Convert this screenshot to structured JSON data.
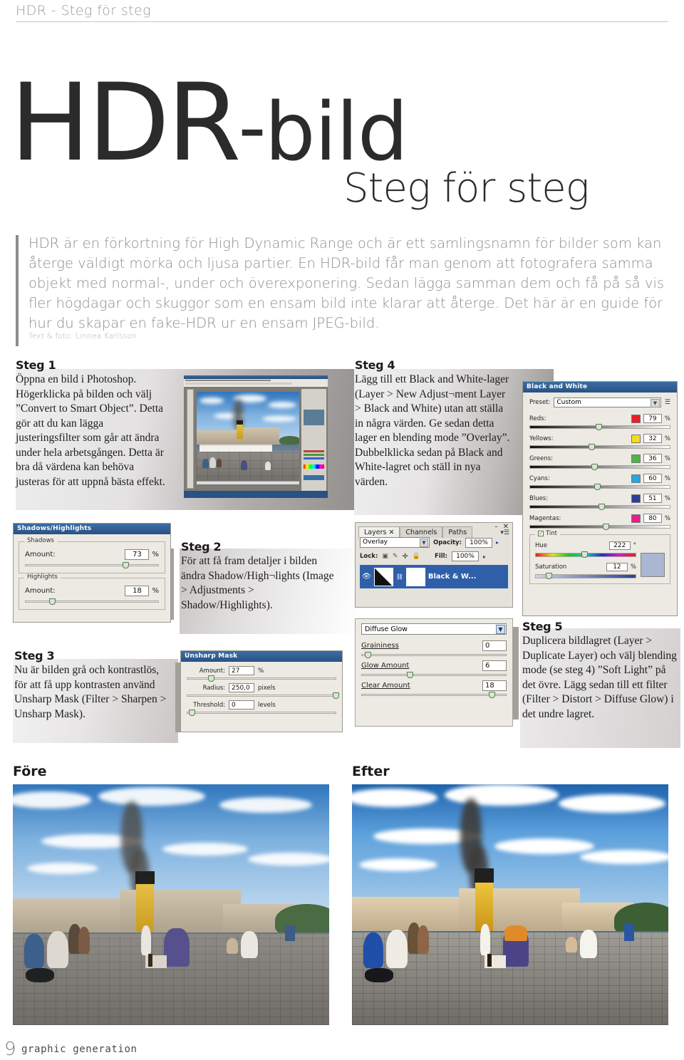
{
  "header": {
    "runhead": "HDR - Steg för steg"
  },
  "title": {
    "main_prefix": "HDR",
    "main_dash": "-",
    "main_suffix": "bild",
    "subtitle": "Steg för steg"
  },
  "intro": {
    "body": "HDR är en förkortning för High Dynamic Range och är ett samlingsnamn för bilder som kan återge väldigt mörka och ljusa partier. En HDR-bild får man genom att fotografera samma objekt med normal-, under och överexponering. Sedan lägga samman dem och få på så vis fler högdagar och skuggor som en ensam bild inte klarar att återge. Det här är en guide för hur du skapar en fake-HDR ur en ensam JPEG-bild.",
    "byline": "Text & foto: Linnea Karlsson"
  },
  "steps": [
    {
      "heading": "Steg 1",
      "body": "Öppna en bild i Photoshop. Högerklicka på bilden och välj ”Convert to Smart Object”. Detta gör att du kan lägga justeringsfilter som går att ändra under hela arbetsgången. Detta är bra då värdena kan behöva justeras för att uppnå bästa effekt."
    },
    {
      "heading": "Steg 2",
      "body": "För att få fram detaljer i bilden ändra Shadow/High¬lights (Image > Adjustments > Shadow/Highlights)."
    },
    {
      "heading": "Steg 3",
      "body": "Nu är bilden grå och kontrastlös, för att få upp kontrasten använd Unsharp Mask (Filter > Sharpen > Unsharp Mask)."
    },
    {
      "heading": "Steg 4",
      "body": "Lägg till ett Black and White-lager (Layer > New Adjust¬ment Layer > Black and White) utan att ställa in några värden. Ge sedan detta lager en blending mode ”Overlay”. Dubbelklicka sedan på Black and White-lagret och ställ in nya värden."
    },
    {
      "heading": "Steg 5",
      "body": "Duplicera bildlagret (Layer > Duplicate Layer) och välj blending mode (se steg 4) ”Soft Light” på det övre. Lägg sedan till ett filter (Filter > Distort > Diffuse Glow) i det undre lagret."
    }
  ],
  "dialogs": {
    "shadows_highlights": {
      "title": "Shadows/Highlights",
      "groups": [
        {
          "legend": "Shadows",
          "label": "Amount:",
          "value": "73",
          "unit": "%",
          "slider_pct": 73
        },
        {
          "legend": "Highlights",
          "label": "Amount:",
          "value": "18",
          "unit": "%",
          "slider_pct": 18
        }
      ]
    },
    "unsharp_mask": {
      "title": "Unsharp Mask",
      "rows": [
        {
          "label": "Amount:",
          "value": "27",
          "unit": "%",
          "slider_pct": 14
        },
        {
          "label": "Radius:",
          "value": "250,0",
          "unit": "pixels",
          "slider_pct": 98
        },
        {
          "label": "Threshold:",
          "value": "0",
          "unit": "levels",
          "slider_pct": 1
        }
      ]
    },
    "layers": {
      "tabs": [
        "Layers",
        "Channels",
        "Paths"
      ],
      "active_tab": "Layers",
      "blend_mode": "Overlay",
      "opacity_label": "Opacity:",
      "opacity_value": "100%",
      "lock_label": "Lock:",
      "fill_label": "Fill:",
      "fill_value": "100%",
      "layer_name": "Black & W...",
      "close_glyph": "✕",
      "minimize_glyph": "–"
    },
    "diffuse_glow": {
      "filter_name": "Diffuse Glow",
      "rows": [
        {
          "label": "Graininess",
          "value": "0",
          "slider_pct": 2
        },
        {
          "label": "Glow Amount",
          "value": "6",
          "slider_pct": 31
        },
        {
          "label": "Clear Amount",
          "value": "18",
          "slider_pct": 88
        }
      ]
    },
    "black_and_white": {
      "title": "Black and White",
      "preset_label": "Preset:",
      "preset_value": "Custom",
      "unit": "%",
      "channels": [
        {
          "label": "Reds:",
          "value": "79",
          "swatch": "#e8202a",
          "slider_pct": 47
        },
        {
          "label": "Yellows:",
          "value": "32",
          "swatch": "#f4dd18",
          "slider_pct": 42
        },
        {
          "label": "Greens:",
          "value": "36",
          "swatch": "#4cb648",
          "slider_pct": 44
        },
        {
          "label": "Cyans:",
          "value": "60",
          "swatch": "#2aa5e0",
          "slider_pct": 46
        },
        {
          "label": "Blues:",
          "value": "51",
          "swatch": "#2b3f97",
          "slider_pct": 49
        },
        {
          "label": "Magentas:",
          "value": "80",
          "swatch": "#ea1d8d",
          "slider_pct": 52
        }
      ],
      "tint": {
        "checkbox_label": "Tint",
        "checked": true,
        "hue_label": "Hue",
        "hue_value": "222",
        "hue_unit": "°",
        "hue_pct": 47,
        "saturation_label": "Saturation",
        "saturation_value": "12",
        "saturation_unit": "%",
        "saturation_pct": 12,
        "preview_color": "#aab6d2"
      }
    }
  },
  "comparison": {
    "before_label": "Före",
    "after_label": "Efter"
  },
  "footer": {
    "page_number": "9",
    "brand": "graphic generation"
  }
}
